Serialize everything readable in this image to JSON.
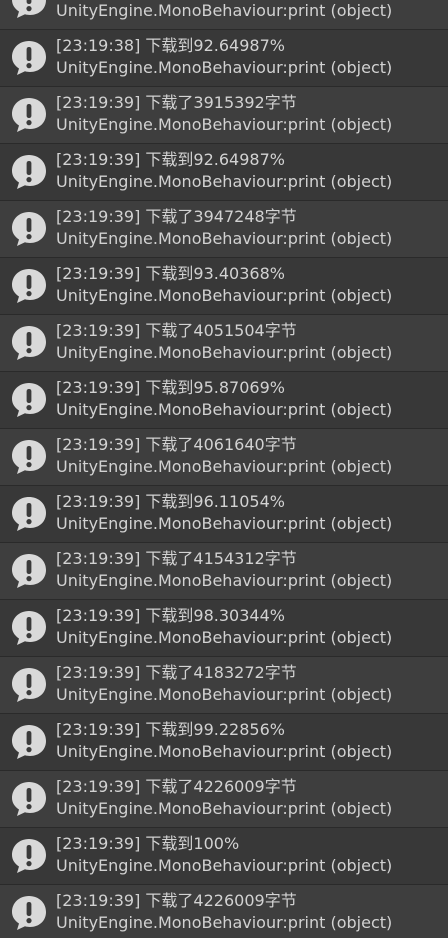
{
  "console": {
    "entries": [
      {
        "message": "",
        "source": "UnityEngine.MonoBehaviour:print (object)",
        "icon": "warning-speech-bubble-icon"
      },
      {
        "message": "[23:19:38] 下载到92.64987%",
        "source": "UnityEngine.MonoBehaviour:print (object)",
        "icon": "warning-speech-bubble-icon"
      },
      {
        "message": "[23:19:39] 下载了3915392字节",
        "source": "UnityEngine.MonoBehaviour:print (object)",
        "icon": "warning-speech-bubble-icon"
      },
      {
        "message": "[23:19:39] 下载到92.64987%",
        "source": "UnityEngine.MonoBehaviour:print (object)",
        "icon": "warning-speech-bubble-icon"
      },
      {
        "message": "[23:19:39] 下载了3947248字节",
        "source": "UnityEngine.MonoBehaviour:print (object)",
        "icon": "warning-speech-bubble-icon"
      },
      {
        "message": "[23:19:39] 下载到93.40368%",
        "source": "UnityEngine.MonoBehaviour:print (object)",
        "icon": "warning-speech-bubble-icon"
      },
      {
        "message": "[23:19:39] 下载了4051504字节",
        "source": "UnityEngine.MonoBehaviour:print (object)",
        "icon": "warning-speech-bubble-icon"
      },
      {
        "message": "[23:19:39] 下载到95.87069%",
        "source": "UnityEngine.MonoBehaviour:print (object)",
        "icon": "warning-speech-bubble-icon"
      },
      {
        "message": "[23:19:39] 下载了4061640字节",
        "source": "UnityEngine.MonoBehaviour:print (object)",
        "icon": "warning-speech-bubble-icon"
      },
      {
        "message": "[23:19:39] 下载到96.11054%",
        "source": "UnityEngine.MonoBehaviour:print (object)",
        "icon": "warning-speech-bubble-icon"
      },
      {
        "message": "[23:19:39] 下载了4154312字节",
        "source": "UnityEngine.MonoBehaviour:print (object)",
        "icon": "warning-speech-bubble-icon"
      },
      {
        "message": "[23:19:39] 下载到98.30344%",
        "source": "UnityEngine.MonoBehaviour:print (object)",
        "icon": "warning-speech-bubble-icon"
      },
      {
        "message": "[23:19:39] 下载了4183272字节",
        "source": "UnityEngine.MonoBehaviour:print (object)",
        "icon": "warning-speech-bubble-icon"
      },
      {
        "message": "[23:19:39] 下载到99.22856%",
        "source": "UnityEngine.MonoBehaviour:print (object)",
        "icon": "warning-speech-bubble-icon"
      },
      {
        "message": "[23:19:39] 下载了4226009字节",
        "source": "UnityEngine.MonoBehaviour:print (object)",
        "icon": "warning-speech-bubble-icon"
      },
      {
        "message": "[23:19:39] 下载到100%",
        "source": "UnityEngine.MonoBehaviour:print (object)",
        "icon": "warning-speech-bubble-icon"
      },
      {
        "message": "[23:19:39] 下载了4226009字节",
        "source": "UnityEngine.MonoBehaviour:print (object)",
        "icon": "warning-speech-bubble-icon"
      }
    ]
  },
  "colors": {
    "background": "#383838",
    "row_alt": "#3e3e3e",
    "separator": "#2a2a2a",
    "text": "#d2d2d2",
    "icon_fill": "#d9d9d9",
    "icon_mark": "#3a3a3a"
  }
}
